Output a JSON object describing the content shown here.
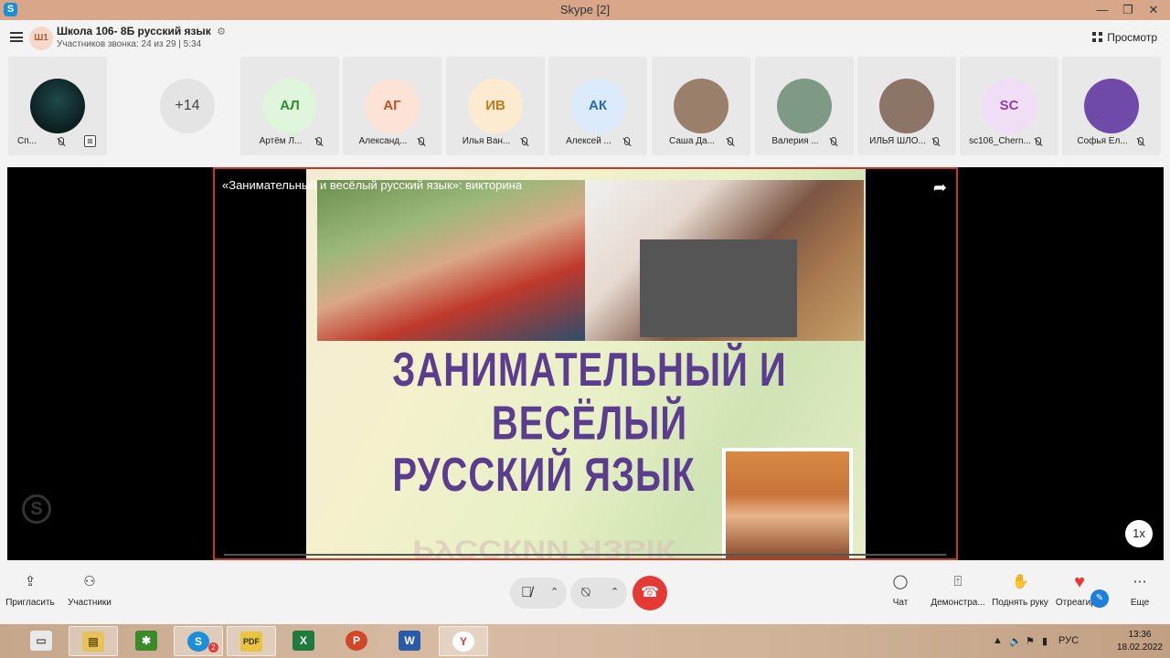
{
  "window": {
    "title": "Skype [2]",
    "app_icon": "S"
  },
  "header": {
    "avatar_initials": "Ш1",
    "conversation_title": "Школа 106- 8Б русский язык",
    "settings_glyph": "⚙",
    "subtitle": "Участников звонка: 24 из 29 | 5:34",
    "view_label": "Просмотр"
  },
  "participants": {
    "first": {
      "name": "Сп...",
      "screen_glyph": "⊠"
    },
    "more_count": "+14",
    "list": [
      {
        "initials": "АЛ",
        "name": "Артём Л...",
        "bg": "#dff5dc",
        "fg": "#2e8b2e"
      },
      {
        "initials": "АГ",
        "name": "Александ...",
        "bg": "#fde3d6",
        "fg": "#c0502a"
      },
      {
        "initials": "ИВ",
        "name": "Илья Ван...",
        "bg": "#fdebd0",
        "fg": "#c07a1e"
      },
      {
        "initials": "АК",
        "name": "Алексей ...",
        "bg": "#dcebfb",
        "fg": "#2768b5"
      },
      {
        "initials": "",
        "name": "Саша Да...",
        "bg": "#9a7f6a",
        "fg": "#fff"
      },
      {
        "initials": "",
        "name": "Валерия ...",
        "bg": "#7e9a86",
        "fg": "#fff"
      },
      {
        "initials": "",
        "name": "ИЛЬЯ ШЛО...",
        "bg": "#8c7466",
        "fg": "#fff"
      },
      {
        "initials": "SC",
        "name": "sc106_Chern...",
        "bg": "#f0def7",
        "fg": "#8a3fb0"
      },
      {
        "initials": "",
        "name": "Софья Ел...",
        "bg": "#6f4aa8",
        "fg": "#fff"
      }
    ]
  },
  "shared_screen": {
    "title": "«Занимательный и весёлый русский язык»: викторина",
    "slide_line1": "ЗАНИМАТЕЛЬНЫЙ И ВЕСЁЛЫЙ",
    "slide_line2": "РУССКИЙ ЯЗЫК",
    "slide_reflection": "РУССКИЙ ЯЗЫК",
    "speed": "1x",
    "share_glyph": "➦"
  },
  "toolbar": {
    "invite": "Пригласить",
    "participants": "Участники",
    "chat": "Чат",
    "share": "Демонстра...",
    "raise_hand": "Поднять руку",
    "react": "Отреагир...",
    "more": "Еще"
  },
  "taskbar": {
    "apps": [
      "explorer",
      "folder",
      "dr-web",
      "skype",
      "pdf",
      "excel",
      "powerpoint",
      "word",
      "yandex"
    ],
    "skype_badge": "2",
    "pdf_label": "PDF",
    "lang": "РУС",
    "time": "13:36",
    "date": "18.02.2022"
  }
}
